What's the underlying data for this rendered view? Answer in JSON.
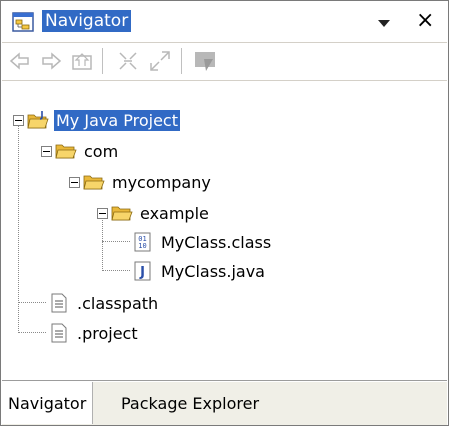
{
  "title": "Navigator",
  "toolbar": {
    "buttons": [
      "back-arrow-icon",
      "forward-arrow-icon",
      "up-folder-icon",
      "collapse-all-icon",
      "link-with-editor-icon",
      "filter-icon"
    ]
  },
  "tree": {
    "project": "My Java Project",
    "com": "com",
    "mycompany": "mycompany",
    "example": "example",
    "class_file": "MyClass.class",
    "java_file": "MyClass.java",
    "classpath": ".classpath",
    "project_file": ".project"
  },
  "tabs": [
    "Navigator",
    "Package Explorer"
  ],
  "colors": {
    "selection": "#316ac5",
    "folder": "#f5c842",
    "java_blue": "#2a4ea8"
  }
}
